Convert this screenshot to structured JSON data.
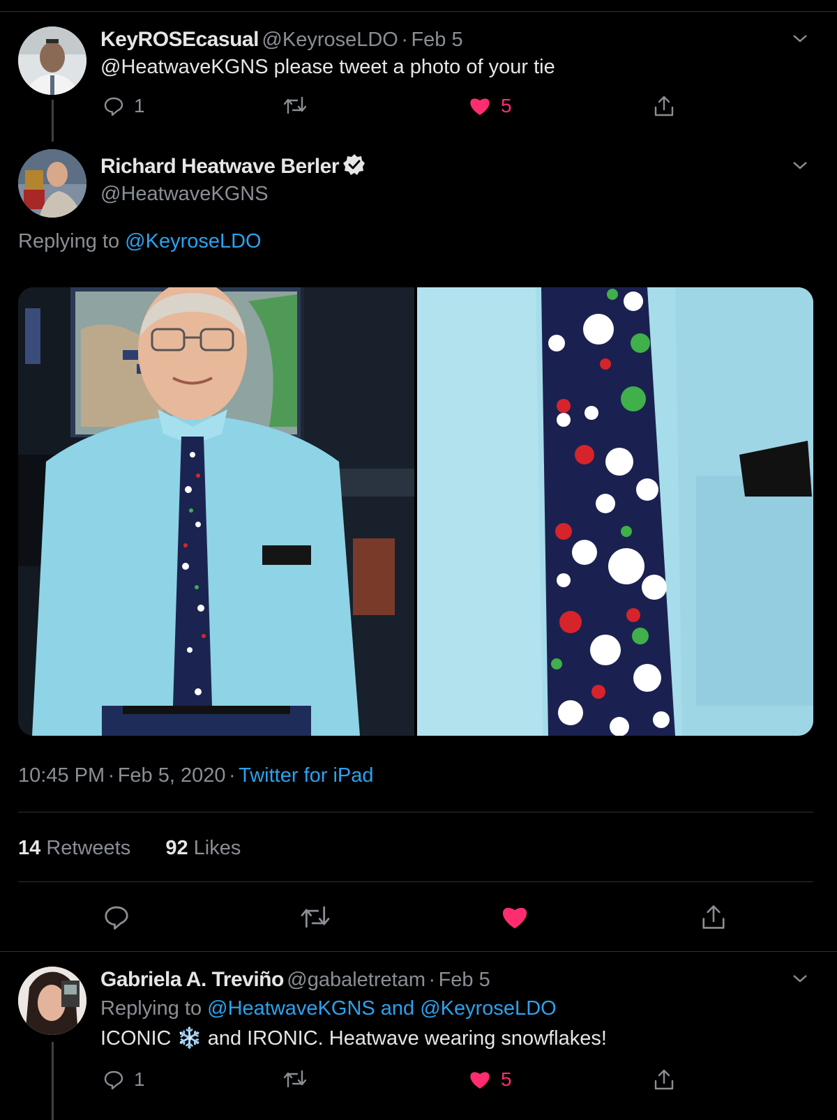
{
  "tweet1": {
    "name": "KeyROSEcasual",
    "handle": "@KeyroseLDO",
    "date": "Feb 5",
    "mention": "@HeatwaveKGNS",
    "text": " please tweet a photo of your tie",
    "reply_count": "1",
    "like_count": "5"
  },
  "tweet2": {
    "name": "Richard Heatwave Berler",
    "handle": "@HeatwaveKGNS",
    "replying_prefix": "Replying to ",
    "replying_to": "@KeyroseLDO",
    "time": "10:45 PM",
    "date": "Feb 5, 2020",
    "source": "Twitter for iPad",
    "retweets_count": "14",
    "retweets_label": " Retweets",
    "likes_count": "92",
    "likes_label": " Likes"
  },
  "tweet3": {
    "name": "Gabriela A. Treviño",
    "handle": "@gabaletretam",
    "date": "Feb 5",
    "replying_prefix": "Replying to ",
    "replying_to": "@HeatwaveKGNS and @KeyroseLDO",
    "text_part1": "ICONIC ",
    "emoji": "❄️",
    "text_part2": " and IRONIC. Heatwave wearing snowflakes!",
    "reply_count": "1",
    "like_count": "5"
  },
  "separator": "·",
  "colors": {
    "background": "#000000",
    "link": "#2aa3ef",
    "like": "#ff2d6f",
    "muted": "#8a8f94"
  },
  "icons": [
    "reply-icon",
    "retweet-icon",
    "heart-icon",
    "share-icon",
    "chevron-down-icon",
    "verified-icon",
    "snowflake-icon"
  ]
}
